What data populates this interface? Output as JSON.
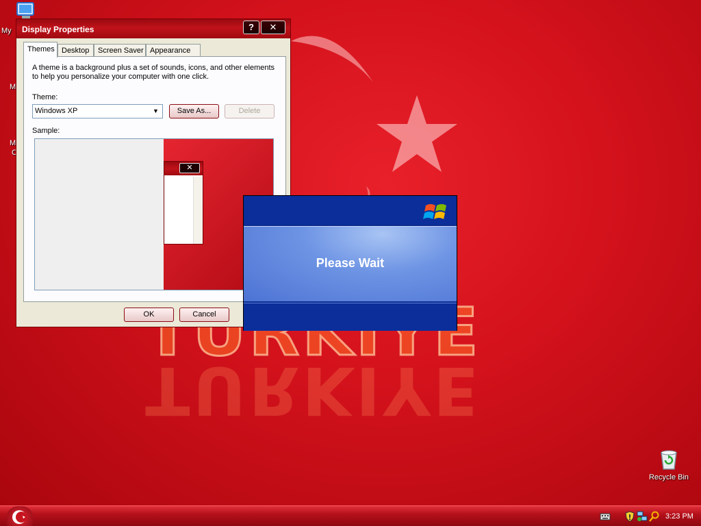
{
  "wallpaper": {
    "text": "TÜRKIYE",
    "colors": {
      "flag_red": "#d4121c",
      "accent": "#ff6e28"
    }
  },
  "desktop": {
    "icons": [
      {
        "label": "My",
        "icon": "my-computer-icon"
      },
      {
        "label": "M",
        "icon": "my-documents-icon"
      },
      {
        "label": "M",
        "icon": "my-network-icon"
      },
      {
        "label": "C",
        "icon": "my-network-icon"
      },
      {
        "label": "Recycle Bin",
        "icon": "recycle-bin-icon"
      }
    ]
  },
  "display_properties": {
    "title": "Display Properties",
    "help_label": "?",
    "close_label": "✕",
    "tabs": [
      "Themes",
      "Desktop",
      "Screen Saver",
      "Appearance"
    ],
    "active_tab": "Themes",
    "description": "A theme is a background plus a set of sounds, icons, and other elements to help you personalize your computer with one click.",
    "theme_label": "Theme:",
    "theme_value": "Windows XP",
    "save_as_label": "Save As...",
    "delete_label": "Delete",
    "sample_label": "Sample:",
    "ok_label": "OK",
    "cancel_label": "Cancel"
  },
  "please_wait": {
    "message": "Please Wait"
  },
  "taskbar": {
    "clock": "3:23 PM"
  }
}
